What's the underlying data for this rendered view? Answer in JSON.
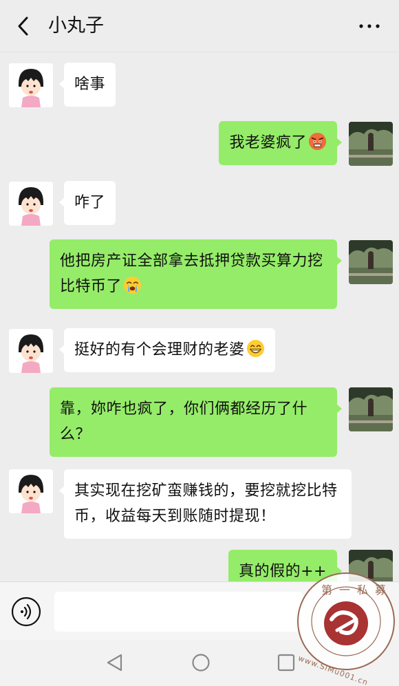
{
  "header": {
    "title": "小丸子",
    "back_icon": "chevron-left-icon",
    "more_icon": "more-dots-icon"
  },
  "messages": [
    {
      "side": "in",
      "text": "啥事"
    },
    {
      "side": "out",
      "text": "我老婆疯了",
      "emoji": "angry-face-emoji"
    },
    {
      "side": "in",
      "text": "咋了"
    },
    {
      "side": "out",
      "text": "他把房产证全部拿去抵押贷款买算力挖比特币了",
      "emoji": "crying-face-emoji"
    },
    {
      "side": "in",
      "text": "挺好的有个会理财的老婆",
      "emoji": "grinning-face-emoji"
    },
    {
      "side": "out",
      "text": "靠，妳咋也疯了，你们俩都经历了什么？"
    },
    {
      "side": "in",
      "text": "其实现在挖矿蛮赚钱的，要挖就挖比特币，收益每天到账随时提现！"
    },
    {
      "side": "out",
      "text": "真的假的++"
    }
  ],
  "input": {
    "voice_icon": "voice-wave-icon",
    "value": ""
  },
  "navbar": {
    "back_icon": "triangle-back-icon",
    "home_icon": "circle-home-icon",
    "recent_icon": "square-recent-icon"
  },
  "watermark": {
    "top_text": "第一私募",
    "url_text": "www.SiMu001.cn"
  },
  "colors": {
    "background": "#ededed",
    "outgoing_bubble": "#95ec69",
    "incoming_bubble": "#ffffff",
    "seal": "#9a6a55"
  }
}
